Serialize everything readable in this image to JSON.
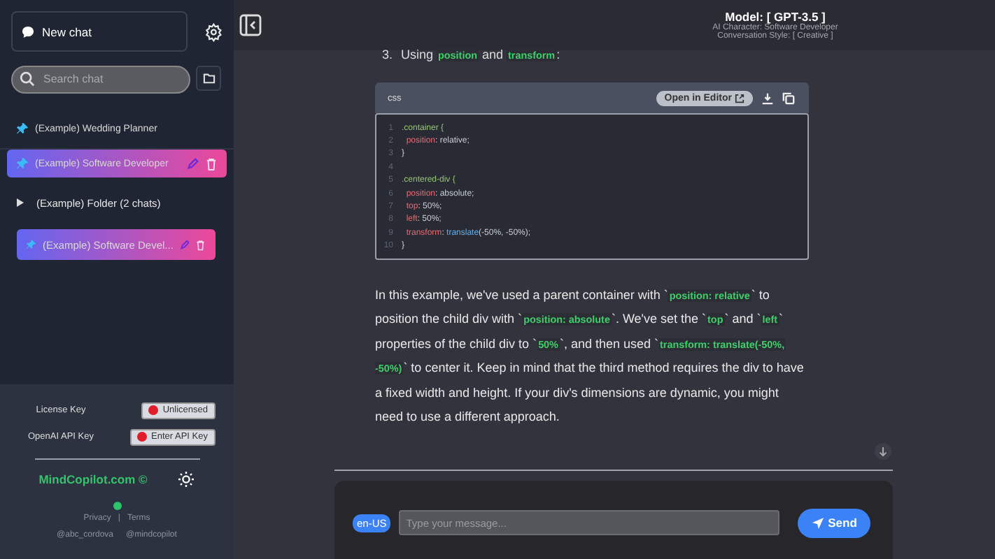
{
  "sidebar": {
    "new_chat": "New chat",
    "search": {
      "placeholder": "Search chat"
    },
    "chats": [
      {
        "kind": "chat",
        "label": "(Example) Wedding Planner",
        "pinned": true,
        "selected": false
      },
      {
        "kind": "chat",
        "label": "(Example) Software Developer",
        "pinned": true,
        "selected": true
      },
      {
        "kind": "folder",
        "label": "(Example) Folder (2 chats)",
        "children": [
          {
            "kind": "chat",
            "label": "(Example) Software Devel...",
            "pinned": true,
            "selected": true
          }
        ]
      }
    ],
    "license": {
      "label": "License Key",
      "status": "Unlicensed"
    },
    "api_key": {
      "label": "OpenAI API Key",
      "status": "Enter API Key"
    },
    "brand": "MindCopilot.com ©",
    "links": {
      "items": [
        "Privacy",
        "Terms"
      ],
      "separator": "|"
    },
    "handles": [
      "@abc_cordova",
      "@mindcopilot"
    ]
  },
  "header": {
    "model": "Model: [ GPT-3.5 ]",
    "character": "AI Character: Software Developer",
    "style": "Conversation Style: [ Creative ]"
  },
  "message": {
    "list_number": "3.",
    "list_text": "Using **position** and **transform**:",
    "code": {
      "language": "css",
      "open_button": "Open in Editor",
      "lines": [
        {
          "number": "1",
          "tokens": [
            {
              "kind": "sel",
              "text": ".container {"
            }
          ]
        },
        {
          "number": "2",
          "tokens": [
            {
              "kind": "prop",
              "text": "  position"
            },
            {
              "kind": "plain",
              "text": ": relative;"
            }
          ]
        },
        {
          "number": "3",
          "tokens": [
            {
              "kind": "plain",
              "text": "}"
            }
          ]
        },
        {
          "number": "4"
        },
        {
          "number": "5",
          "tokens": [
            {
              "kind": "sel",
              "text": ".centered-div {"
            }
          ]
        },
        {
          "number": "6",
          "tokens": [
            {
              "kind": "prop",
              "text": "  position"
            },
            {
              "kind": "plain",
              "text": ": absolute;"
            }
          ]
        },
        {
          "number": "7",
          "tokens": [
            {
              "kind": "prop",
              "text": "  top"
            },
            {
              "kind": "plain",
              "text": ": 50%;"
            }
          ]
        },
        {
          "number": "8",
          "tokens": [
            {
              "kind": "prop",
              "text": "  left"
            },
            {
              "kind": "plain",
              "text": ": 50%;"
            }
          ]
        },
        {
          "number": "9",
          "tokens": [
            {
              "kind": "prop",
              "text": "  transform"
            },
            {
              "kind": "plain",
              "text": ": "
            },
            {
              "kind": "fn",
              "text": "translate"
            },
            {
              "kind": "plain",
              "text": "(-50%, -50%);"
            }
          ]
        },
        {
          "number": "10",
          "tokens": [
            {
              "kind": "plain",
              "text": "}"
            }
          ]
        }
      ]
    },
    "paragraph": "In this example, we've used a parent container with `**position: relative**` to position the child div with `**position: absolute**`. We've set the `**top**` and `**left**` properties of the child div to `**50%**`, and then used `**transform: translate(-50%, -50%)**` to center it. Keep in mind that the third method requires the div to have a fixed width and height. If your div's dimensions are dynamic, you might need to use a different approach."
  },
  "composer": {
    "language": "en-US",
    "placeholder": "Type your message...",
    "send": "Send"
  }
}
